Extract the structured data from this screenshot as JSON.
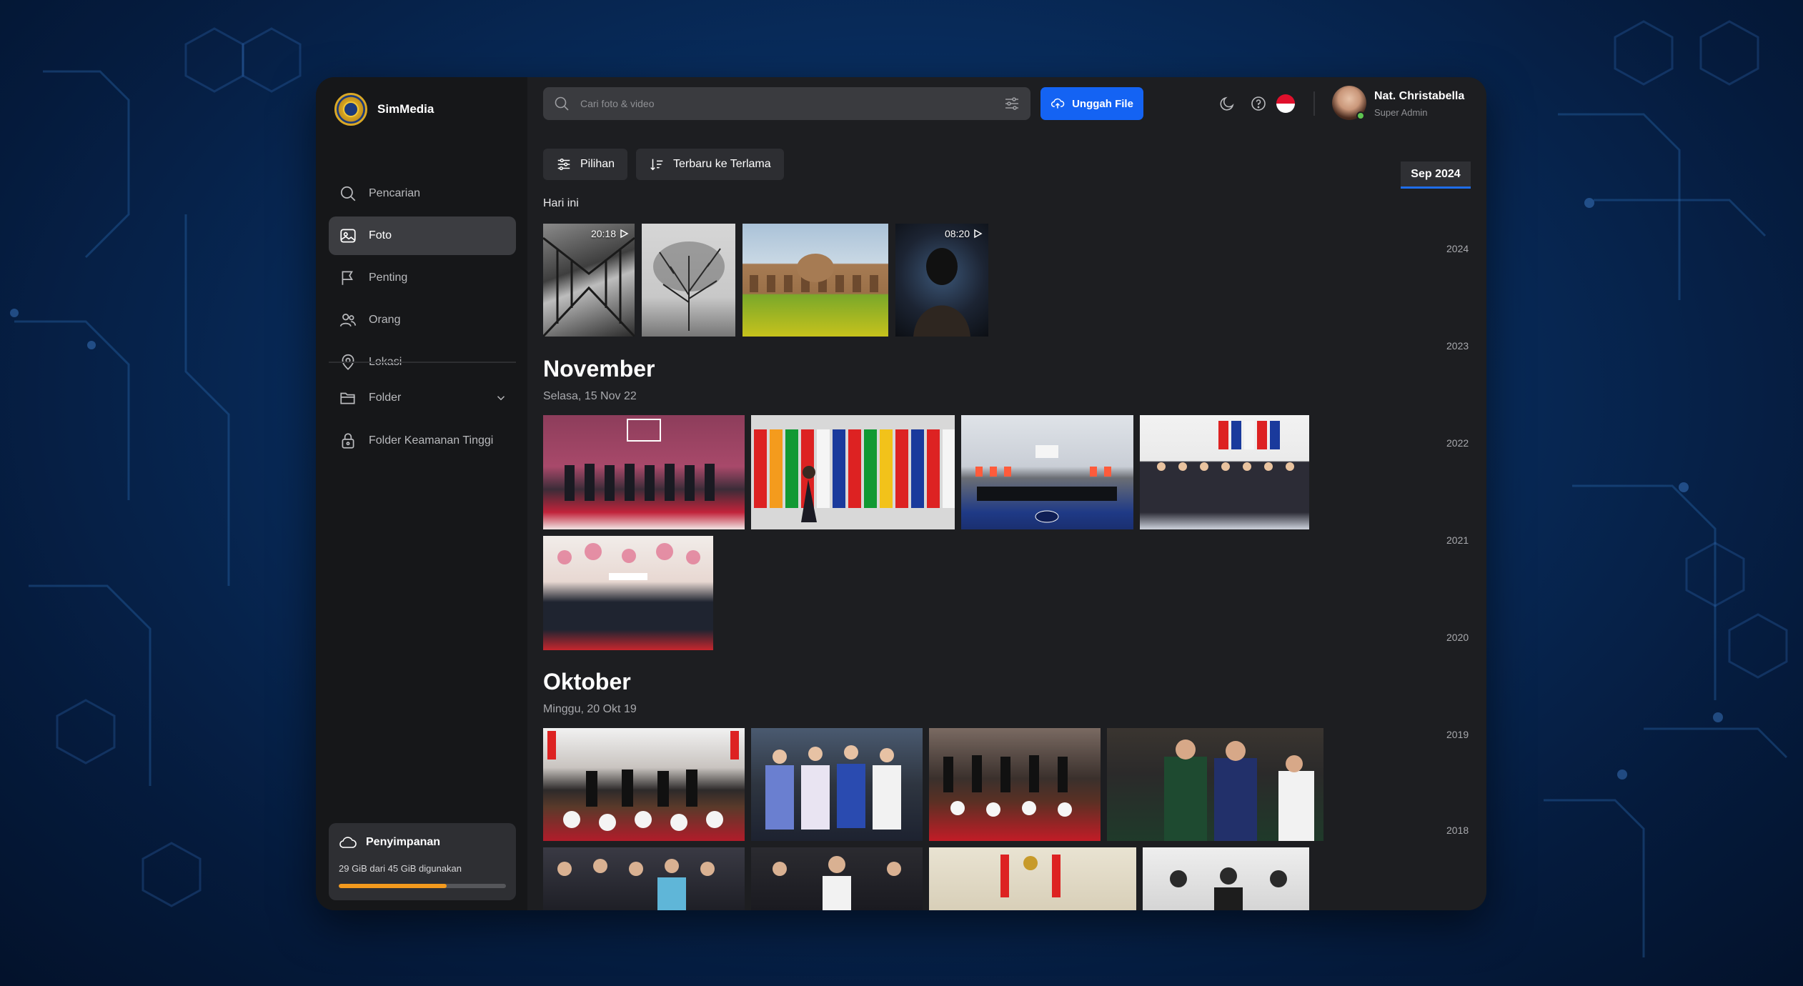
{
  "brand": {
    "name": "SimMedia"
  },
  "nav": {
    "items": [
      {
        "label": "Pencarian",
        "icon": "search-icon",
        "active": false
      },
      {
        "label": "Foto",
        "icon": "photo-icon",
        "active": true
      },
      {
        "label": "Penting",
        "icon": "flag-icon",
        "active": false
      },
      {
        "label": "Orang",
        "icon": "people-icon",
        "active": false
      },
      {
        "label": "Lokasi",
        "icon": "location-icon",
        "active": false
      }
    ],
    "folder_label": "Folder",
    "secure_folder_label": "Folder Keamanan Tinggi"
  },
  "storage": {
    "title": "Penyimpanan",
    "usage_text": "29 GiB dari 45 GiB digunakan",
    "used_fraction": 0.644,
    "bar_color": "#f39a1e"
  },
  "topbar": {
    "search_placeholder": "Cari foto & video",
    "upload_label": "Unggah File",
    "user_name": "Nat. Christabella",
    "user_role": "Super Admin"
  },
  "toolbar": {
    "options_label": "Pilihan",
    "sort_label": "Terbaru ke Terlama",
    "current_date": "Sep 2024"
  },
  "sections": {
    "today_label": "Hari ini",
    "today_durations": [
      "20:18",
      "08:20"
    ],
    "november_title": "November",
    "november_date": "Selasa, 15 Nov 22",
    "oktober_title": "Oktober",
    "oktober_date": "Minggu, 20 Okt 19"
  },
  "years": [
    "2024",
    "2023",
    "2022",
    "2021",
    "2020",
    "2019",
    "2018"
  ],
  "colors": {
    "accent": "#1463f3",
    "active_nav": "#3c3d41",
    "date_underline": "#1f6de9"
  }
}
